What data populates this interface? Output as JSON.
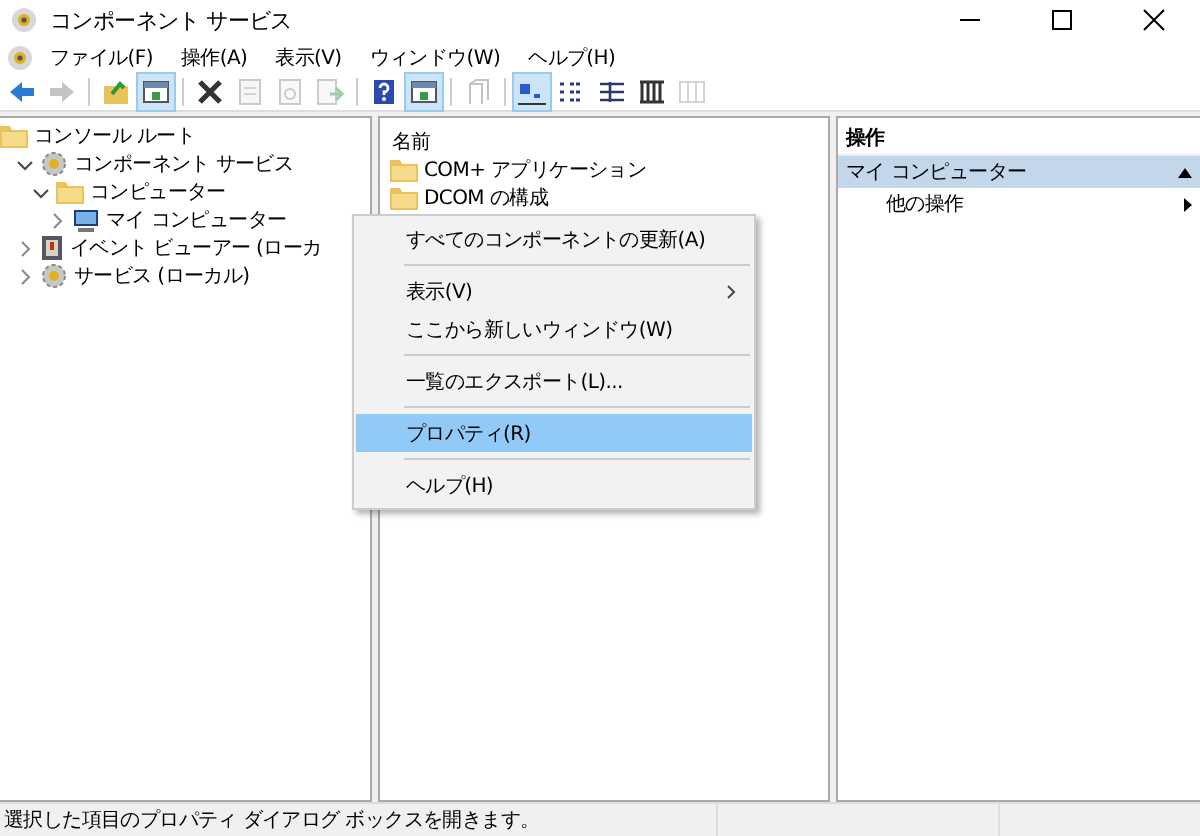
{
  "window": {
    "title": "コンポーネント サービス"
  },
  "menu": [
    "ファイル(F)",
    "操作(A)",
    "表示(V)",
    "ウィンドウ(W)",
    "ヘルプ(H)"
  ],
  "toolbar": [
    {
      "kind": "back",
      "disabled": false,
      "pressed": false
    },
    {
      "kind": "forward",
      "disabled": true,
      "pressed": false
    },
    {
      "kind": "sep"
    },
    {
      "kind": "up",
      "disabled": false,
      "pressed": false
    },
    {
      "kind": "pane",
      "disabled": false,
      "pressed": true
    },
    {
      "kind": "sep"
    },
    {
      "kind": "delete",
      "disabled": false,
      "pressed": false
    },
    {
      "kind": "props",
      "disabled": true,
      "pressed": false
    },
    {
      "kind": "refresh",
      "disabled": true,
      "pressed": false
    },
    {
      "kind": "export",
      "disabled": true,
      "pressed": false
    },
    {
      "kind": "sep"
    },
    {
      "kind": "help",
      "disabled": false,
      "pressed": false
    },
    {
      "kind": "pane",
      "disabled": false,
      "pressed": true
    },
    {
      "kind": "sep"
    },
    {
      "kind": "levelup",
      "disabled": true,
      "pressed": false
    },
    {
      "kind": "sep"
    },
    {
      "kind": "large",
      "disabled": false,
      "pressed": true
    },
    {
      "kind": "small",
      "disabled": false,
      "pressed": false
    },
    {
      "kind": "list",
      "disabled": false,
      "pressed": false
    },
    {
      "kind": "details",
      "disabled": false,
      "pressed": false
    },
    {
      "kind": "custom",
      "disabled": true,
      "pressed": false
    }
  ],
  "tree": [
    {
      "label": "コンソール ルート",
      "kind": "folder",
      "children": [
        {
          "label": "コンポーネント サービス",
          "kind": "gear",
          "expanded": true,
          "children": [
            {
              "label": "コンピューター",
              "kind": "folder",
              "expanded": true,
              "children": [
                {
                  "label": "マイ コンピューター",
                  "kind": "computer",
                  "expanded": false
                }
              ]
            }
          ]
        },
        {
          "label": "イベント ビューアー (ローカ",
          "kind": "log",
          "expanded": false
        },
        {
          "label": "サービス (ローカル)",
          "kind": "gear",
          "expanded": false
        }
      ]
    }
  ],
  "list": {
    "column": "名前",
    "items": [
      "COM+ アプリケーション",
      "DCOM の構成"
    ]
  },
  "actions": {
    "header": "操作",
    "section": "マイ コンピューター",
    "items": [
      "他の操作"
    ]
  },
  "context_menu": [
    {
      "kind": "item",
      "label": "すべてのコンポーネントの更新(A)",
      "selected": false
    },
    {
      "kind": "sep"
    },
    {
      "kind": "submenu",
      "label": "表示(V)",
      "selected": false
    },
    {
      "kind": "item",
      "label": "ここから新しいウィンドウ(W)",
      "selected": false
    },
    {
      "kind": "sep"
    },
    {
      "kind": "item",
      "label": "一覧のエクスポート(L)...",
      "selected": false
    },
    {
      "kind": "sep"
    },
    {
      "kind": "item",
      "label": "プロパティ(R)",
      "selected": true
    },
    {
      "kind": "sep"
    },
    {
      "kind": "item",
      "label": "ヘルプ(H)",
      "selected": false
    }
  ],
  "status_bar": "選択した項目のプロパティ ダイアログ ボックスを開きます。"
}
